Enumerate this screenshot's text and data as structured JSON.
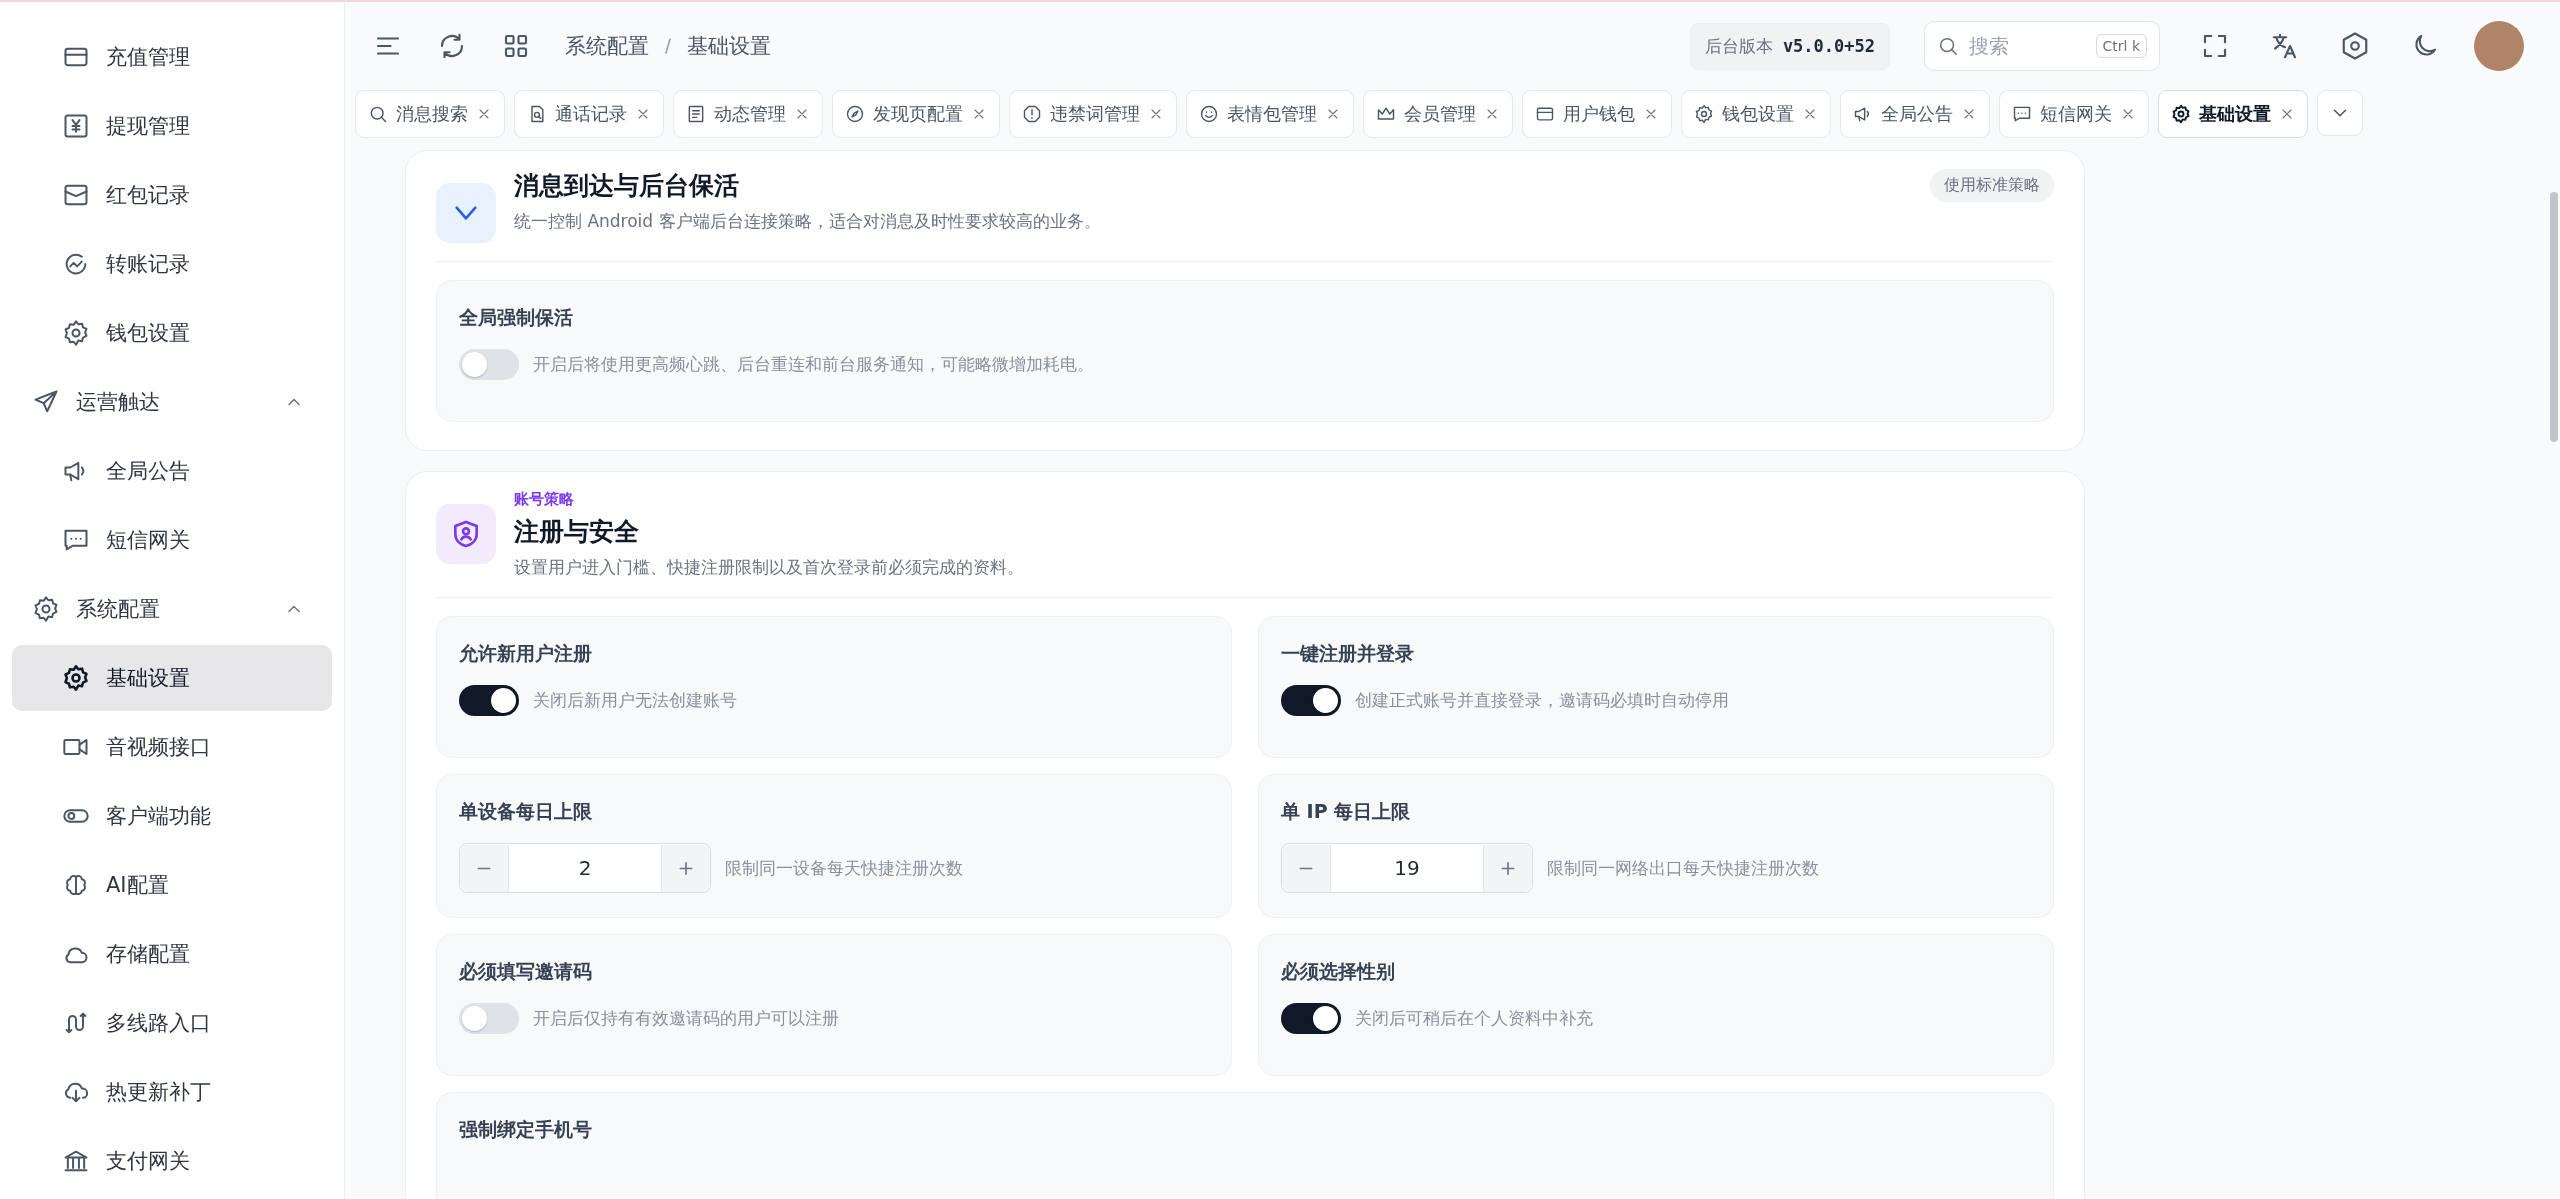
{
  "sidebar": {
    "items": [
      {
        "kind": "group",
        "children": [
          {
            "kind": "item",
            "label": "充值管理",
            "selected": false
          },
          {
            "kind": "item",
            "label": "提现管理",
            "selected": false
          },
          {
            "kind": "item",
            "label": "红包记录",
            "selected": false
          },
          {
            "kind": "item",
            "label": "转账记录",
            "selected": false
          },
          {
            "kind": "item",
            "label": "钱包设置",
            "selected": false
          }
        ]
      },
      {
        "kind": "group",
        "label": "运营触达",
        "expanded": true,
        "children": [
          {
            "kind": "item",
            "label": "全局公告",
            "selected": false
          },
          {
            "kind": "item",
            "label": "短信网关",
            "selected": false
          }
        ]
      },
      {
        "kind": "group",
        "label": "系统配置",
        "expanded": true,
        "children": [
          {
            "kind": "item",
            "label": "基础设置",
            "selected": true
          },
          {
            "kind": "item",
            "label": "音视频接口",
            "selected": false
          },
          {
            "kind": "item",
            "label": "客户端功能",
            "selected": false
          },
          {
            "kind": "item",
            "label": "AI配置",
            "selected": false
          },
          {
            "kind": "item",
            "label": "存储配置",
            "selected": false
          },
          {
            "kind": "item",
            "label": "多线路入口",
            "selected": false
          },
          {
            "kind": "item",
            "label": "热更新补丁",
            "selected": false
          },
          {
            "kind": "item",
            "label": "支付网关",
            "selected": false
          }
        ]
      }
    ]
  },
  "header": {
    "breadcrumbs": [
      "系统配置",
      "基础设置"
    ],
    "version_label": "后台版本",
    "version": "v5.0.0+52",
    "search": {
      "placeholder": "搜索",
      "shortcut": "Ctrl k"
    }
  },
  "tabs": [
    {
      "label": "消息搜索",
      "selected": false
    },
    {
      "label": "通话记录",
      "selected": false
    },
    {
      "label": "动态管理",
      "selected": false
    },
    {
      "label": "发现页配置",
      "selected": false
    },
    {
      "label": "违禁词管理",
      "selected": false
    },
    {
      "label": "表情包管理",
      "selected": false
    },
    {
      "label": "会员管理",
      "selected": false
    },
    {
      "label": "用户钱包",
      "selected": false
    },
    {
      "label": "钱包设置",
      "selected": false
    },
    {
      "label": "全局公告",
      "selected": false
    },
    {
      "label": "短信网关",
      "selected": false
    },
    {
      "label": "基础设置",
      "selected": true
    }
  ],
  "sections": [
    {
      "title": "消息到达与后台保活",
      "description": "统一控制 Android 客户端后台连接策略，适合对消息及时性要求较高的业务。",
      "badge": "使用标准策略",
      "settings": [
        {
          "kind": "switch",
          "wide": true,
          "label": "全局强制保活",
          "on": false,
          "hint": "开启后将使用更高频心跳、后台重连和前台服务通知，可能略微增加耗电。"
        }
      ]
    },
    {
      "eyebrow": "账号策略",
      "title": "注册与安全",
      "description": "设置用户进入门槛、快捷注册限制以及首次登录前必须完成的资料。",
      "settings": [
        {
          "kind": "switch",
          "wide": false,
          "label": "允许新用户注册",
          "on": true,
          "hint": "关闭后新用户无法创建账号"
        },
        {
          "kind": "switch",
          "wide": false,
          "label": "一键注册并登录",
          "on": true,
          "hint": "创建正式账号并直接登录，邀请码必填时自动停用"
        },
        {
          "kind": "stepper",
          "wide": false,
          "label": "单设备每日上限",
          "value": "2",
          "hint": "限制同一设备每天快捷注册次数"
        },
        {
          "kind": "stepper",
          "wide": false,
          "label": "单 IP 每日上限",
          "value": "19",
          "hint": "限制同一网络出口每天快捷注册次数"
        },
        {
          "kind": "switch",
          "wide": false,
          "label": "必须填写邀请码",
          "on": false,
          "hint": "开启后仅持有有效邀请码的用户可以注册"
        },
        {
          "kind": "switch",
          "wide": false,
          "label": "必须选择性别",
          "on": true,
          "hint": "关闭后可稍后在个人资料中补充"
        },
        {
          "kind": "label",
          "wide": true,
          "label": "强制绑定手机号"
        }
      ]
    }
  ]
}
